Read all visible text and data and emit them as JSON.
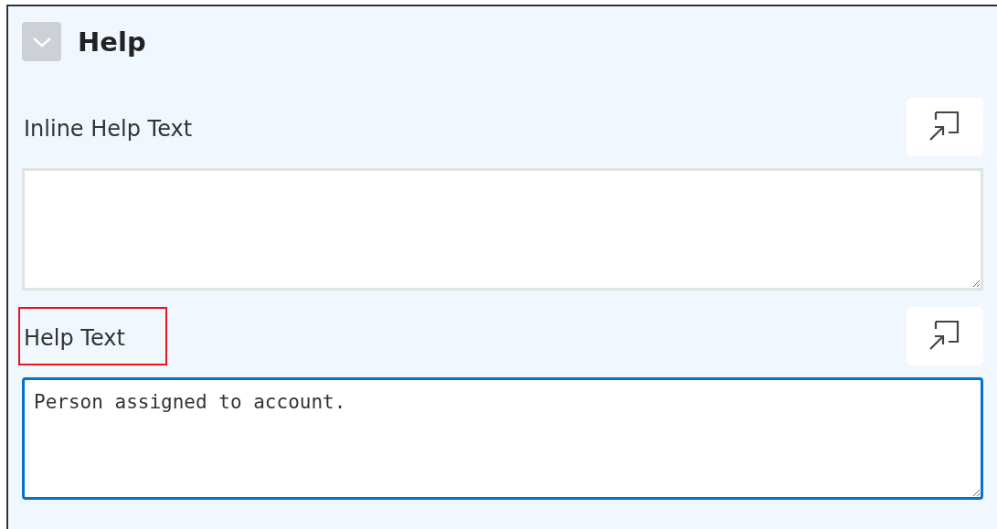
{
  "section": {
    "title": "Help",
    "expanded": true
  },
  "fields": [
    {
      "label": "Inline Help Text",
      "focused": false,
      "highlighted": false
    },
    {
      "label": "Help Text",
      "value": "Person assigned to account.",
      "focused": true,
      "highlighted": true
    }
  ]
}
